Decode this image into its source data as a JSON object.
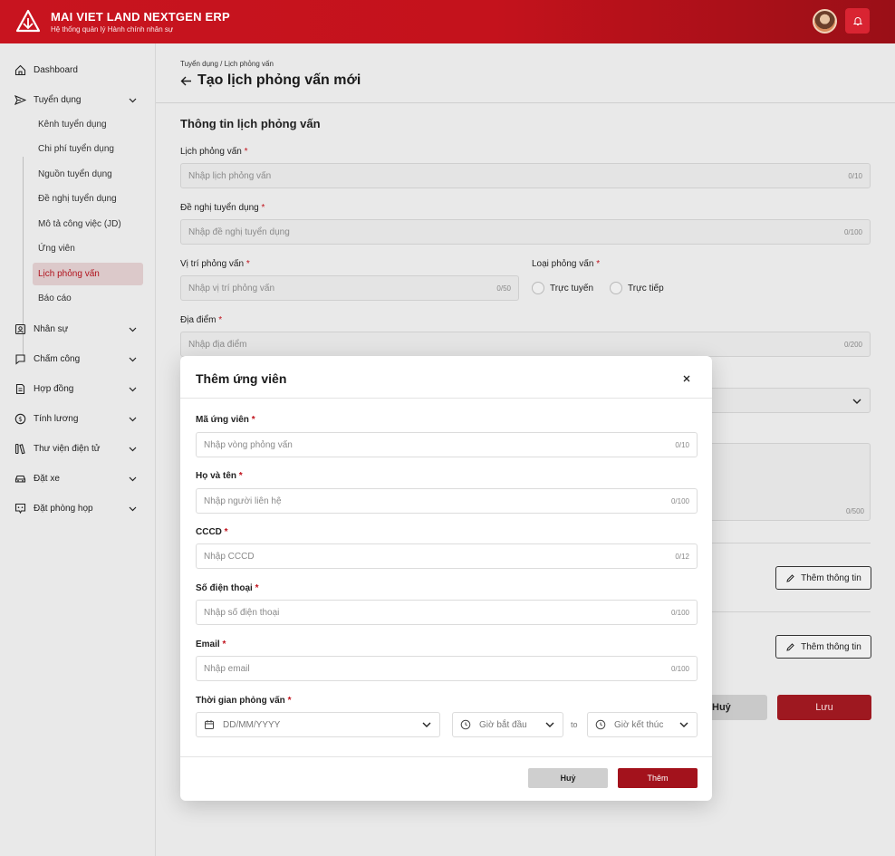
{
  "header": {
    "brand_title": "MAI VIET LAND NEXTGEN ERP",
    "brand_subtitle": "Hệ thống quản lý Hành chính nhân sự"
  },
  "sidebar": {
    "items": [
      {
        "label": "Dashboard",
        "icon": "home-icon"
      },
      {
        "label": "Tuyển dụng",
        "icon": "send-icon"
      },
      {
        "label": "Nhân sự",
        "icon": "person-card-icon"
      },
      {
        "label": "Chấm công",
        "icon": "clock-card-icon"
      },
      {
        "label": "Hợp đồng",
        "icon": "document-icon"
      },
      {
        "label": "Tính lương",
        "icon": "dollar-icon"
      },
      {
        "label": "Thư viện điện tử",
        "icon": "library-icon"
      },
      {
        "label": "Đặt xe",
        "icon": "car-icon"
      },
      {
        "label": "Đặt phòng họp",
        "icon": "meeting-icon"
      }
    ],
    "sub_items": [
      {
        "label": "Kênh tuyển dụng"
      },
      {
        "label": "Chi phí tuyển dụng"
      },
      {
        "label": "Nguồn tuyển dụng"
      },
      {
        "label": "Đề nghị tuyển dụng"
      },
      {
        "label": "Mô tả công việc (JD)"
      },
      {
        "label": "Ứng viên"
      },
      {
        "label": "Lịch phỏng vấn",
        "active": true
      },
      {
        "label": "Báo cáo"
      }
    ]
  },
  "main": {
    "breadcrumb": "Tuyển dụng / Lịch phỏng vấn",
    "title": "Tạo lịch phỏng vấn mới",
    "section_title": "Thông tin lịch phỏng vấn",
    "fields": {
      "schedule": {
        "label": "Lịch phỏng vấn",
        "placeholder": "Nhập lịch phỏng vấn",
        "count": "0/10"
      },
      "proposal": {
        "label": "Đề nghị tuyển dụng",
        "placeholder": "Nhập đề nghị tuyển dụng",
        "count": "0/100"
      },
      "position": {
        "label": "Vị trí phỏng vấn",
        "placeholder": "Nhập vị trí phỏng vấn",
        "count": "0/50"
      },
      "type": {
        "label": "Loại phỏng vấn",
        "options": [
          "Trực tuyến",
          "Trực tiếp"
        ]
      },
      "location": {
        "label": "Địa điểm",
        "placeholder": "Nhập địa điểm",
        "count": "0/200"
      },
      "notes_count": "0/500"
    },
    "add_info_label": "Thêm thông tin",
    "cancel_label": "Huỷ",
    "save_label": "Lưu"
  },
  "modal": {
    "title": "Thêm ứng viên",
    "fields": {
      "code": {
        "label": "Mã ứng viên",
        "placeholder": "Nhập vòng phỏng vấn",
        "count": "0/10"
      },
      "name": {
        "label": "Họ và tên",
        "placeholder": "Nhập người liên hệ",
        "count": "0/100"
      },
      "cccd": {
        "label": "CCCD",
        "placeholder": "Nhập CCCD",
        "count": "0/12"
      },
      "phone": {
        "label": "Số điện thoại",
        "placeholder": "Nhập số điện thoại",
        "count": "0/100"
      },
      "email": {
        "label": "Email",
        "placeholder": "Nhập email",
        "count": "0/100"
      },
      "time": {
        "label": "Thời gian phỏng vấn",
        "date_placeholder": "DD/MM/YYYY",
        "start_placeholder": "Giờ bắt đầu",
        "to": "to",
        "end_placeholder": "Giờ kết thúc"
      }
    },
    "cancel_label": "Huỷ",
    "add_label": "Thêm"
  },
  "colors": {
    "brand": "#c8141f",
    "primary_button": "#a3121c",
    "active_nav_bg": "#dcc9ca"
  }
}
